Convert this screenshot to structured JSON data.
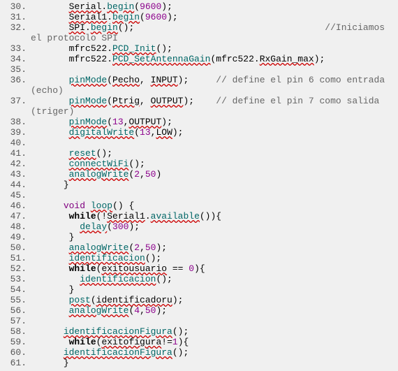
{
  "lines": [
    {
      "n": "30.",
      "tokens": [
        {
          "t": "       ",
          "c": ""
        },
        {
          "t": "Serial",
          "c": "err"
        },
        {
          "t": ".",
          "c": ""
        },
        {
          "t": "begin",
          "c": "fn err"
        },
        {
          "t": "(",
          "c": ""
        },
        {
          "t": "9600",
          "c": "num"
        },
        {
          "t": ");",
          "c": ""
        }
      ]
    },
    {
      "n": "31.",
      "tokens": [
        {
          "t": "       ",
          "c": ""
        },
        {
          "t": "Serial1",
          "c": "err"
        },
        {
          "t": ".",
          "c": ""
        },
        {
          "t": "begin",
          "c": "fn err"
        },
        {
          "t": "(",
          "c": ""
        },
        {
          "t": "9600",
          "c": "num"
        },
        {
          "t": ");",
          "c": ""
        }
      ]
    },
    {
      "n": "32.",
      "tokens": [
        {
          "t": "       ",
          "c": ""
        },
        {
          "t": "SPI",
          "c": "err"
        },
        {
          "t": ".",
          "c": ""
        },
        {
          "t": "begin",
          "c": "fn err"
        },
        {
          "t": "();                                   ",
          "c": ""
        },
        {
          "t": "//Iniciamos el protocolo SPI",
          "c": "comment"
        }
      ]
    },
    {
      "n": "33.",
      "tokens": [
        {
          "t": "       mfrc522.",
          "c": ""
        },
        {
          "t": "PCD_Init",
          "c": "fn err"
        },
        {
          "t": "();",
          "c": ""
        }
      ]
    },
    {
      "n": "34.",
      "tokens": [
        {
          "t": "       mfrc522.",
          "c": ""
        },
        {
          "t": "PCD_SetAntennaGain",
          "c": "fn err"
        },
        {
          "t": "(mfrc522.",
          "c": ""
        },
        {
          "t": "RxGain_max",
          "c": "err"
        },
        {
          "t": ");",
          "c": ""
        }
      ]
    },
    {
      "n": "35.",
      "tokens": [
        {
          "t": "  ",
          "c": ""
        }
      ]
    },
    {
      "n": "36.",
      "tokens": [
        {
          "t": "       ",
          "c": ""
        },
        {
          "t": "pinMode",
          "c": "fn err"
        },
        {
          "t": "(",
          "c": ""
        },
        {
          "t": "Pecho",
          "c": "err"
        },
        {
          "t": ", ",
          "c": ""
        },
        {
          "t": "INPUT",
          "c": "err"
        },
        {
          "t": ");     ",
          "c": ""
        },
        {
          "t": "// define el pin 6 como entrada (echo)",
          "c": "comment"
        }
      ]
    },
    {
      "n": "37.",
      "tokens": [
        {
          "t": "       ",
          "c": ""
        },
        {
          "t": "pinMode",
          "c": "fn err"
        },
        {
          "t": "(",
          "c": ""
        },
        {
          "t": "Ptrig",
          "c": "err"
        },
        {
          "t": ", ",
          "c": ""
        },
        {
          "t": "OUTPUT",
          "c": "err"
        },
        {
          "t": ");    ",
          "c": ""
        },
        {
          "t": "// define el pin 7 como salida  (triger)",
          "c": "comment"
        }
      ]
    },
    {
      "n": "38.",
      "tokens": [
        {
          "t": "       ",
          "c": ""
        },
        {
          "t": "pinMode",
          "c": "fn err"
        },
        {
          "t": "(",
          "c": ""
        },
        {
          "t": "13",
          "c": "num"
        },
        {
          "t": ",",
          "c": ""
        },
        {
          "t": "OUTPUT",
          "c": "err"
        },
        {
          "t": ");",
          "c": ""
        }
      ]
    },
    {
      "n": "39.",
      "tokens": [
        {
          "t": "       ",
          "c": ""
        },
        {
          "t": "digitalWrite",
          "c": "fn err"
        },
        {
          "t": "(",
          "c": ""
        },
        {
          "t": "13",
          "c": "num"
        },
        {
          "t": ",",
          "c": ""
        },
        {
          "t": "LOW",
          "c": "err"
        },
        {
          "t": ");",
          "c": ""
        }
      ]
    },
    {
      "n": "40.",
      "tokens": [
        {
          "t": "  ",
          "c": ""
        }
      ]
    },
    {
      "n": "41.",
      "tokens": [
        {
          "t": "       ",
          "c": ""
        },
        {
          "t": "reset",
          "c": "fn err"
        },
        {
          "t": "();",
          "c": ""
        }
      ]
    },
    {
      "n": "42.",
      "tokens": [
        {
          "t": "       ",
          "c": ""
        },
        {
          "t": "connectWiFi",
          "c": "fn err"
        },
        {
          "t": "();",
          "c": ""
        }
      ]
    },
    {
      "n": "43.",
      "tokens": [
        {
          "t": "       ",
          "c": ""
        },
        {
          "t": "analogWrite",
          "c": "fn err"
        },
        {
          "t": "(",
          "c": ""
        },
        {
          "t": "2",
          "c": "num"
        },
        {
          "t": ",",
          "c": ""
        },
        {
          "t": "50",
          "c": "num"
        },
        {
          "t": ")",
          "c": ""
        }
      ]
    },
    {
      "n": "44.",
      "tokens": [
        {
          "t": "      }",
          "c": ""
        }
      ]
    },
    {
      "n": "45.",
      "tokens": [
        {
          "t": "  ",
          "c": ""
        }
      ]
    },
    {
      "n": "46.",
      "tokens": [
        {
          "t": "      ",
          "c": ""
        },
        {
          "t": "void",
          "c": "kw"
        },
        {
          "t": " ",
          "c": ""
        },
        {
          "t": "loop",
          "c": "fn err"
        },
        {
          "t": "() {",
          "c": ""
        }
      ]
    },
    {
      "n": "47.",
      "tokens": [
        {
          "t": "       ",
          "c": ""
        },
        {
          "t": "while",
          "c": "ctrl"
        },
        {
          "t": "(!",
          "c": ""
        },
        {
          "t": "Serial1",
          "c": "err"
        },
        {
          "t": ".",
          "c": ""
        },
        {
          "t": "available",
          "c": "fn err"
        },
        {
          "t": "()){",
          "c": ""
        }
      ]
    },
    {
      "n": "48.",
      "tokens": [
        {
          "t": "         ",
          "c": ""
        },
        {
          "t": "delay",
          "c": "fn err"
        },
        {
          "t": "(",
          "c": ""
        },
        {
          "t": "300",
          "c": "num"
        },
        {
          "t": ");",
          "c": ""
        }
      ]
    },
    {
      "n": "49.",
      "tokens": [
        {
          "t": "       }",
          "c": ""
        }
      ]
    },
    {
      "n": "50.",
      "tokens": [
        {
          "t": "       ",
          "c": ""
        },
        {
          "t": "analogWrite",
          "c": "fn err"
        },
        {
          "t": "(",
          "c": ""
        },
        {
          "t": "2",
          "c": "num"
        },
        {
          "t": ",",
          "c": ""
        },
        {
          "t": "50",
          "c": "num"
        },
        {
          "t": ");",
          "c": ""
        }
      ]
    },
    {
      "n": "51.",
      "tokens": [
        {
          "t": "       ",
          "c": ""
        },
        {
          "t": "identificacion",
          "c": "fn err"
        },
        {
          "t": "();",
          "c": ""
        }
      ]
    },
    {
      "n": "52.",
      "tokens": [
        {
          "t": "       ",
          "c": ""
        },
        {
          "t": "while",
          "c": "ctrl"
        },
        {
          "t": "(",
          "c": ""
        },
        {
          "t": "exitousuario",
          "c": "err"
        },
        {
          "t": " == ",
          "c": ""
        },
        {
          "t": "0",
          "c": "num"
        },
        {
          "t": "){",
          "c": ""
        }
      ]
    },
    {
      "n": "53.",
      "tokens": [
        {
          "t": "         ",
          "c": ""
        },
        {
          "t": "identificacion",
          "c": "fn err"
        },
        {
          "t": "();",
          "c": ""
        }
      ]
    },
    {
      "n": "54.",
      "tokens": [
        {
          "t": "       }",
          "c": ""
        }
      ]
    },
    {
      "n": "55.",
      "tokens": [
        {
          "t": "       ",
          "c": ""
        },
        {
          "t": "post",
          "c": "fn err"
        },
        {
          "t": "(",
          "c": ""
        },
        {
          "t": "identificadoru",
          "c": "err"
        },
        {
          "t": ");",
          "c": ""
        }
      ]
    },
    {
      "n": "56.",
      "tokens": [
        {
          "t": "       ",
          "c": ""
        },
        {
          "t": "analogWrite",
          "c": "fn err"
        },
        {
          "t": "(",
          "c": ""
        },
        {
          "t": "4",
          "c": "num"
        },
        {
          "t": ",",
          "c": ""
        },
        {
          "t": "50",
          "c": "num"
        },
        {
          "t": ");",
          "c": ""
        }
      ]
    },
    {
      "n": "57.",
      "tokens": [
        {
          "t": "  ",
          "c": ""
        }
      ]
    },
    {
      "n": "58.",
      "tokens": [
        {
          "t": "      ",
          "c": ""
        },
        {
          "t": "identificacionFigura",
          "c": "fn err"
        },
        {
          "t": "();",
          "c": ""
        }
      ]
    },
    {
      "n": "59.",
      "tokens": [
        {
          "t": "       ",
          "c": ""
        },
        {
          "t": "while",
          "c": "ctrl"
        },
        {
          "t": "(",
          "c": ""
        },
        {
          "t": "exitofigura",
          "c": "err"
        },
        {
          "t": "!=",
          "c": ""
        },
        {
          "t": "1",
          "c": "num"
        },
        {
          "t": "){",
          "c": ""
        }
      ]
    },
    {
      "n": "60.",
      "tokens": [
        {
          "t": "      ",
          "c": ""
        },
        {
          "t": "identificacionFigura",
          "c": "fn err"
        },
        {
          "t": "();",
          "c": ""
        }
      ]
    },
    {
      "n": "61.",
      "tokens": [
        {
          "t": "      }",
          "c": ""
        }
      ]
    }
  ]
}
